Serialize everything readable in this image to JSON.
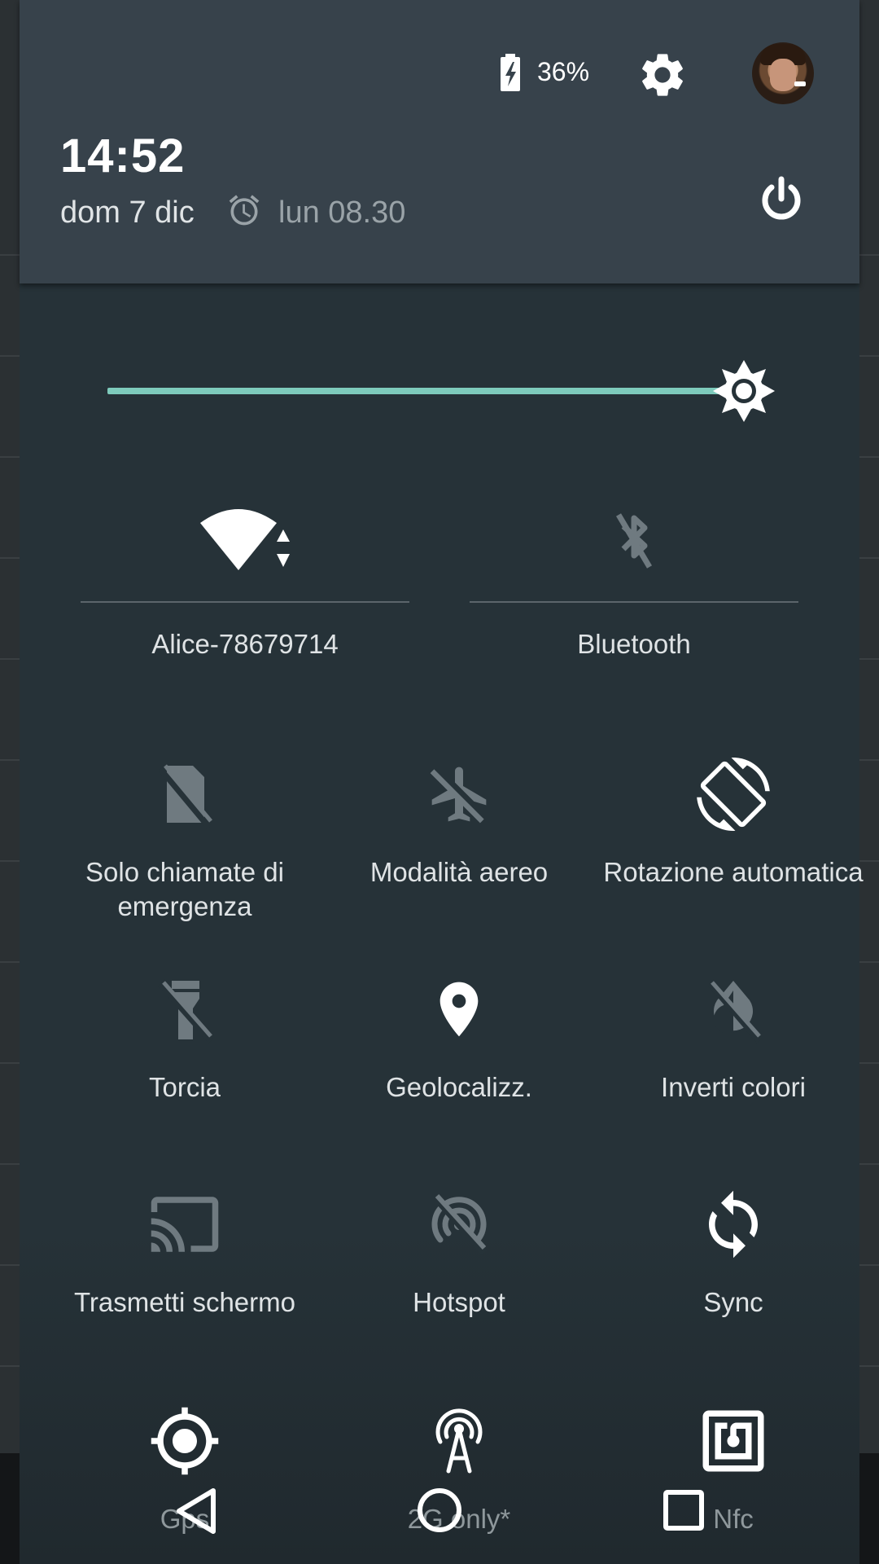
{
  "status": {
    "battery_percent": "36%",
    "battery_charging": true
  },
  "header": {
    "time": "14:52",
    "date": "dom 7 dic",
    "alarm": "lun 08.30"
  },
  "brightness": {
    "level": 0.92,
    "track_color": "#7ecbbc"
  },
  "tiles_big": [
    {
      "label": "Alice-78679714",
      "icon": "wifi-icon",
      "active": true
    },
    {
      "label": "Bluetooth",
      "icon": "bluetooth-off-icon",
      "active": false
    }
  ],
  "tiles": [
    {
      "label": "Solo chiamate di emergenza",
      "icon": "no-sim-icon",
      "active": false
    },
    {
      "label": "Modalità aereo",
      "icon": "airplane-off-icon",
      "active": false
    },
    {
      "label": "Rotazione automatica",
      "icon": "screen-rotation-icon",
      "active": true
    },
    {
      "label": "Torcia",
      "icon": "flashlight-off-icon",
      "active": false
    },
    {
      "label": "Geolocalizz.",
      "icon": "location-icon",
      "active": true
    },
    {
      "label": "Inverti colori",
      "icon": "invert-colors-off-icon",
      "active": false
    },
    {
      "label": "Trasmetti schermo",
      "icon": "cast-icon",
      "active": false
    },
    {
      "label": "Hotspot",
      "icon": "hotspot-off-icon",
      "active": false
    },
    {
      "label": "Sync",
      "icon": "sync-icon",
      "active": true
    },
    {
      "label": "Gps",
      "icon": "gps-icon",
      "active": true
    },
    {
      "label": "2G only*",
      "icon": "antenna-icon",
      "active": true
    },
    {
      "label": "Nfc",
      "icon": "nfc-icon",
      "active": true
    }
  ],
  "colors": {
    "panel_bg": "#263238",
    "header_bg": "#37424b",
    "active_icon": "#ffffff",
    "inactive_icon": "#6f7a80"
  }
}
